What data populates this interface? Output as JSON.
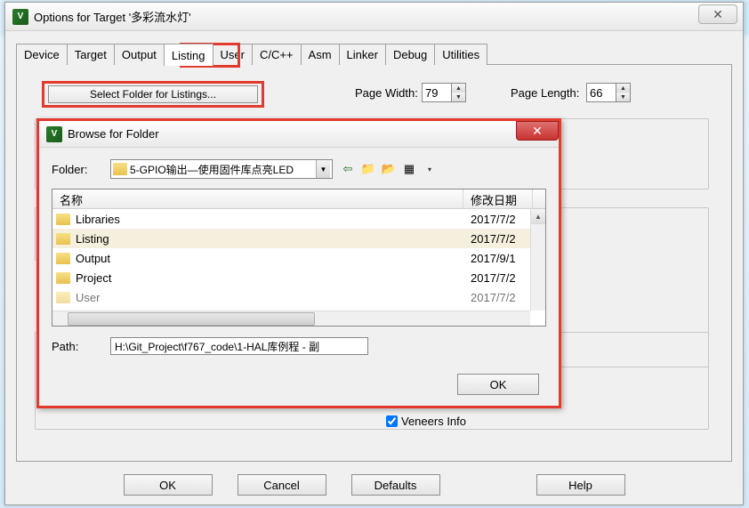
{
  "main": {
    "title": "Options for Target '多彩流水灯'",
    "close_glyph": "✕",
    "tabs": [
      "Device",
      "Target",
      "Output",
      "Listing",
      "User",
      "C/C++",
      "Asm",
      "Linker",
      "Debug",
      "Utilities"
    ],
    "active_tab": "Listing",
    "select_folder_label": "Select Folder for Listings...",
    "page_width_label": "Page Width:",
    "page_width_value": "79",
    "page_length_label": "Page Length:",
    "page_length_value": "66",
    "veneers_label": "Veneers Info",
    "buttons": {
      "ok": "OK",
      "cancel": "Cancel",
      "defaults": "Defaults",
      "help": "Help"
    }
  },
  "browse": {
    "title": "Browse for Folder",
    "close_glyph": "✕",
    "folder_label": "Folder:",
    "folder_value": "5-GPIO输出—使用固件库点亮LED",
    "toolbar": {
      "back": "⇦",
      "up": "📁",
      "new": "📂",
      "view": "▦",
      "drop": "▾"
    },
    "columns": {
      "name": "名称",
      "date": "修改日期"
    },
    "items": [
      {
        "name": "Libraries",
        "date": "2017/7/2"
      },
      {
        "name": "Listing",
        "date": "2017/7/2"
      },
      {
        "name": "Output",
        "date": "2017/9/1"
      },
      {
        "name": "Project",
        "date": "2017/7/2"
      },
      {
        "name": "User",
        "date": "2017/7/2"
      }
    ],
    "path_label": "Path:",
    "path_value": "H:\\Git_Project\\f767_code\\1-HAL库例程 - 副",
    "ok_label": "OK"
  }
}
